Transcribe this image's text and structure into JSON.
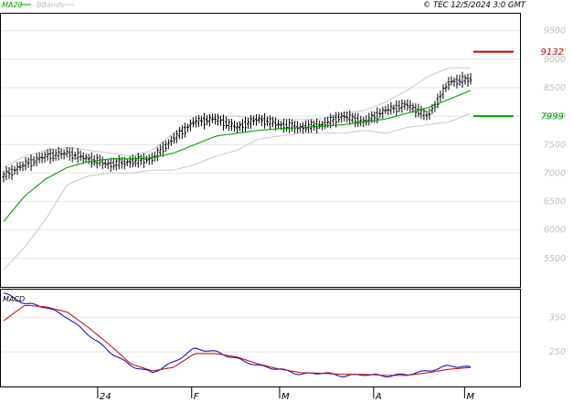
{
  "legend": {
    "ma20_label": "MA20",
    "bbands_label": "BBands",
    "ma20_color": "#00a000",
    "bbands_color": "#c8c8c8"
  },
  "copyright": "© TEC 12/5/2024 3:0 GMT",
  "macd_label": "MACD",
  "chart_data": [
    {
      "type": "line",
      "panel": "price",
      "x": [
        "2023-12-01",
        "2023-12-08",
        "2023-12-15",
        "2023-12-22",
        "2023-12-29",
        "2024-01-05",
        "2024-01-12",
        "2024-01-19",
        "2024-01-26",
        "2024-02-02",
        "2024-02-09",
        "2024-02-16",
        "2024-02-23",
        "2024-03-01",
        "2024-03-08",
        "2024-03-15",
        "2024-03-22",
        "2024-03-29",
        "2024-04-05",
        "2024-04-12",
        "2024-04-19",
        "2024-04-26",
        "2024-05-03"
      ],
      "series": [
        {
          "name": "Price",
          "values": [
            6950,
            7150,
            7300,
            7350,
            7250,
            7150,
            7200,
            7250,
            7600,
            7900,
            7950,
            7800,
            7950,
            7850,
            7800,
            7850,
            8000,
            7900,
            8100,
            8200,
            8000,
            8600,
            8650
          ]
        },
        {
          "name": "MA20",
          "values": [
            6150,
            6600,
            6900,
            7100,
            7200,
            7250,
            7250,
            7270,
            7350,
            7500,
            7650,
            7700,
            7750,
            7780,
            7800,
            7820,
            7850,
            7900,
            7950,
            8050,
            8150,
            8300,
            8450
          ]
        },
        {
          "name": "BBands upper",
          "values": [
            7100,
            7300,
            7400,
            7450,
            7400,
            7350,
            7300,
            7400,
            7700,
            7900,
            8000,
            8000,
            7950,
            7950,
            7950,
            7950,
            8050,
            8100,
            8250,
            8450,
            8700,
            8850,
            8850
          ]
        },
        {
          "name": "BBands lower",
          "values": [
            5300,
            5700,
            6200,
            6800,
            6950,
            7000,
            7000,
            7050,
            7050,
            7150,
            7300,
            7400,
            7600,
            7650,
            7700,
            7700,
            7700,
            7750,
            7700,
            7800,
            7850,
            7900,
            8050
          ]
        }
      ],
      "levels": [
        {
          "label": "9132",
          "value": 9132,
          "color": "#c00000"
        },
        {
          "label": "7999",
          "value": 7999,
          "color": "#00a000"
        }
      ],
      "ylim": [
        5000,
        9800
      ],
      "y_ticks": [
        "9500",
        "9000",
        "8500",
        "8000",
        "7500",
        "7000",
        "6500",
        "6000",
        "5500"
      ],
      "grid": true
    },
    {
      "type": "line",
      "panel": "macd",
      "title": "MACD",
      "x": [
        "2023-12-01",
        "2023-12-08",
        "2023-12-15",
        "2023-12-22",
        "2023-12-29",
        "2024-01-05",
        "2024-01-12",
        "2024-01-19",
        "2024-01-26",
        "2024-02-02",
        "2024-02-09",
        "2024-02-16",
        "2024-02-23",
        "2024-03-01",
        "2024-03-08",
        "2024-03-15",
        "2024-03-22",
        "2024-03-29",
        "2024-04-05",
        "2024-04-12",
        "2024-04-19",
        "2024-04-26",
        "2024-05-03"
      ],
      "series": [
        {
          "name": "MACD",
          "color": "#0000c0",
          "values": [
            420,
            390,
            380,
            350,
            300,
            250,
            210,
            190,
            220,
            260,
            250,
            230,
            210,
            200,
            185,
            190,
            180,
            185,
            180,
            185,
            195,
            210,
            205
          ]
        },
        {
          "name": "Signal",
          "color": "#c00000",
          "values": [
            340,
            385,
            380,
            365,
            320,
            270,
            215,
            195,
            205,
            245,
            245,
            235,
            215,
            200,
            190,
            188,
            185,
            185,
            182,
            182,
            190,
            200,
            205
          ]
        }
      ],
      "ylim": [
        150,
        430
      ],
      "y_ticks": [
        "350",
        "250"
      ],
      "grid": true
    }
  ],
  "x_axis": {
    "labels": [
      {
        "label": "24",
        "date": "2024-01-01"
      },
      {
        "label": "F",
        "date": "2024-02-01"
      },
      {
        "label": "M",
        "date": "2024-03-01"
      },
      {
        "label": "A",
        "date": "2024-04-01"
      },
      {
        "label": "M",
        "date": "2024-05-01"
      }
    ]
  }
}
